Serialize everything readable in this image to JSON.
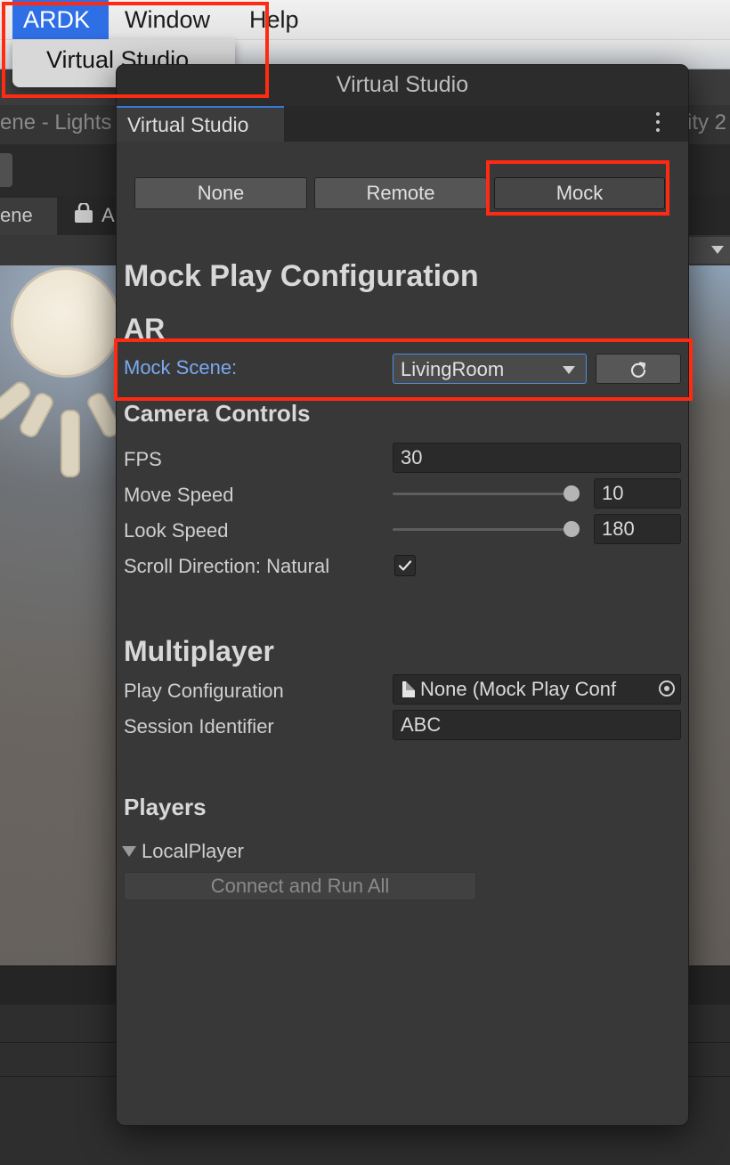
{
  "menubar": {
    "items": [
      "ARDK",
      "Window",
      "Help"
    ],
    "dropdown_item": "Virtual Studio"
  },
  "background": {
    "scene_title_left": "ene - Lights",
    "scene_title_right": "ity 2",
    "tab_scene": "ene",
    "tab_asset": "A"
  },
  "window": {
    "title": "Virtual Studio",
    "tab_label": "Virtual Studio",
    "menu_icon": "kebab-menu-icon"
  },
  "mode_buttons": [
    {
      "label": "None",
      "selected": false
    },
    {
      "label": "Remote",
      "selected": false
    },
    {
      "label": "Mock",
      "selected": true
    }
  ],
  "mock_config": {
    "heading": "Mock Play Configuration",
    "ar_heading": "AR",
    "mock_scene_label": "Mock Scene:",
    "mock_scene_value": "LivingRoom",
    "refresh_icon": "refresh-icon"
  },
  "camera_controls": {
    "heading": "Camera Controls",
    "fps_label": "FPS",
    "fps_value": "30",
    "move_speed_label": "Move Speed",
    "move_speed_value": "10",
    "move_speed_slider_fraction": 1.0,
    "look_speed_label": "Look Speed",
    "look_speed_value": "180",
    "look_speed_slider_fraction": 1.0,
    "scroll_direction_label": "Scroll Direction: Natural",
    "scroll_direction_checked": true
  },
  "multiplayer": {
    "heading": "Multiplayer",
    "play_config_label": "Play Configuration",
    "play_config_value": "None (Mock Play Conf",
    "session_id_label": "Session Identifier",
    "session_id_value": "ABC"
  },
  "players": {
    "heading": "Players",
    "local_player_label": "LocalPlayer",
    "connect_button": "Connect and Run All"
  },
  "colors": {
    "highlight": "#ff2a12",
    "menu_selected": "#2f6fe6",
    "link_label": "#7aa9ef"
  }
}
